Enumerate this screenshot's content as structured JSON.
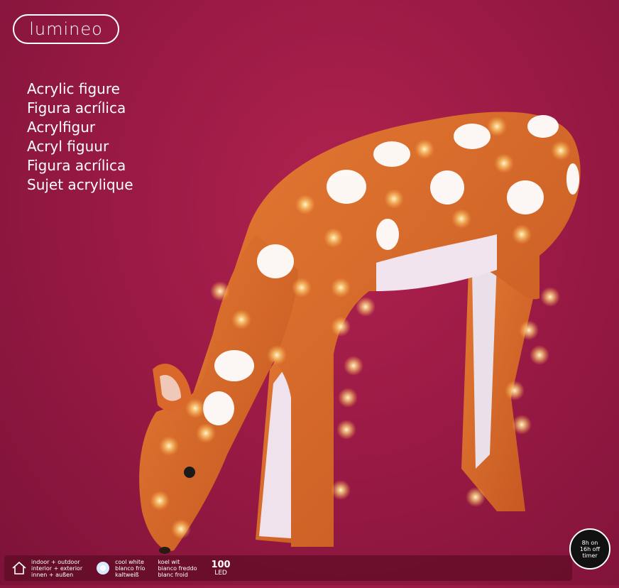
{
  "brand": {
    "logo_text": "lumineo"
  },
  "titles": [
    "Acrylic figure",
    "Figura acrílica",
    "Acrylfigur",
    "Acryl figuur",
    "Figura acrílica",
    "Sujet acrylique"
  ],
  "features": {
    "usage": {
      "icon": "house-icon",
      "lines": [
        "indoor + outdoor",
        "interior + exterior",
        "innen + außen"
      ]
    },
    "light_color_a": {
      "icon": "bulb-icon",
      "lines": [
        "cool white",
        "blanco frío",
        "kaltweiß"
      ]
    },
    "light_color_b": {
      "lines": [
        "koel wit",
        "bianco freddo",
        "blanc froid"
      ]
    },
    "led": {
      "count": "100",
      "unit": "LED"
    }
  },
  "timer": {
    "line1": "8h on",
    "line2": "16h off",
    "line3": "timer"
  },
  "colors": {
    "background": "#9a1a45",
    "fur": "#d9692a",
    "spot": "#ffffff"
  }
}
